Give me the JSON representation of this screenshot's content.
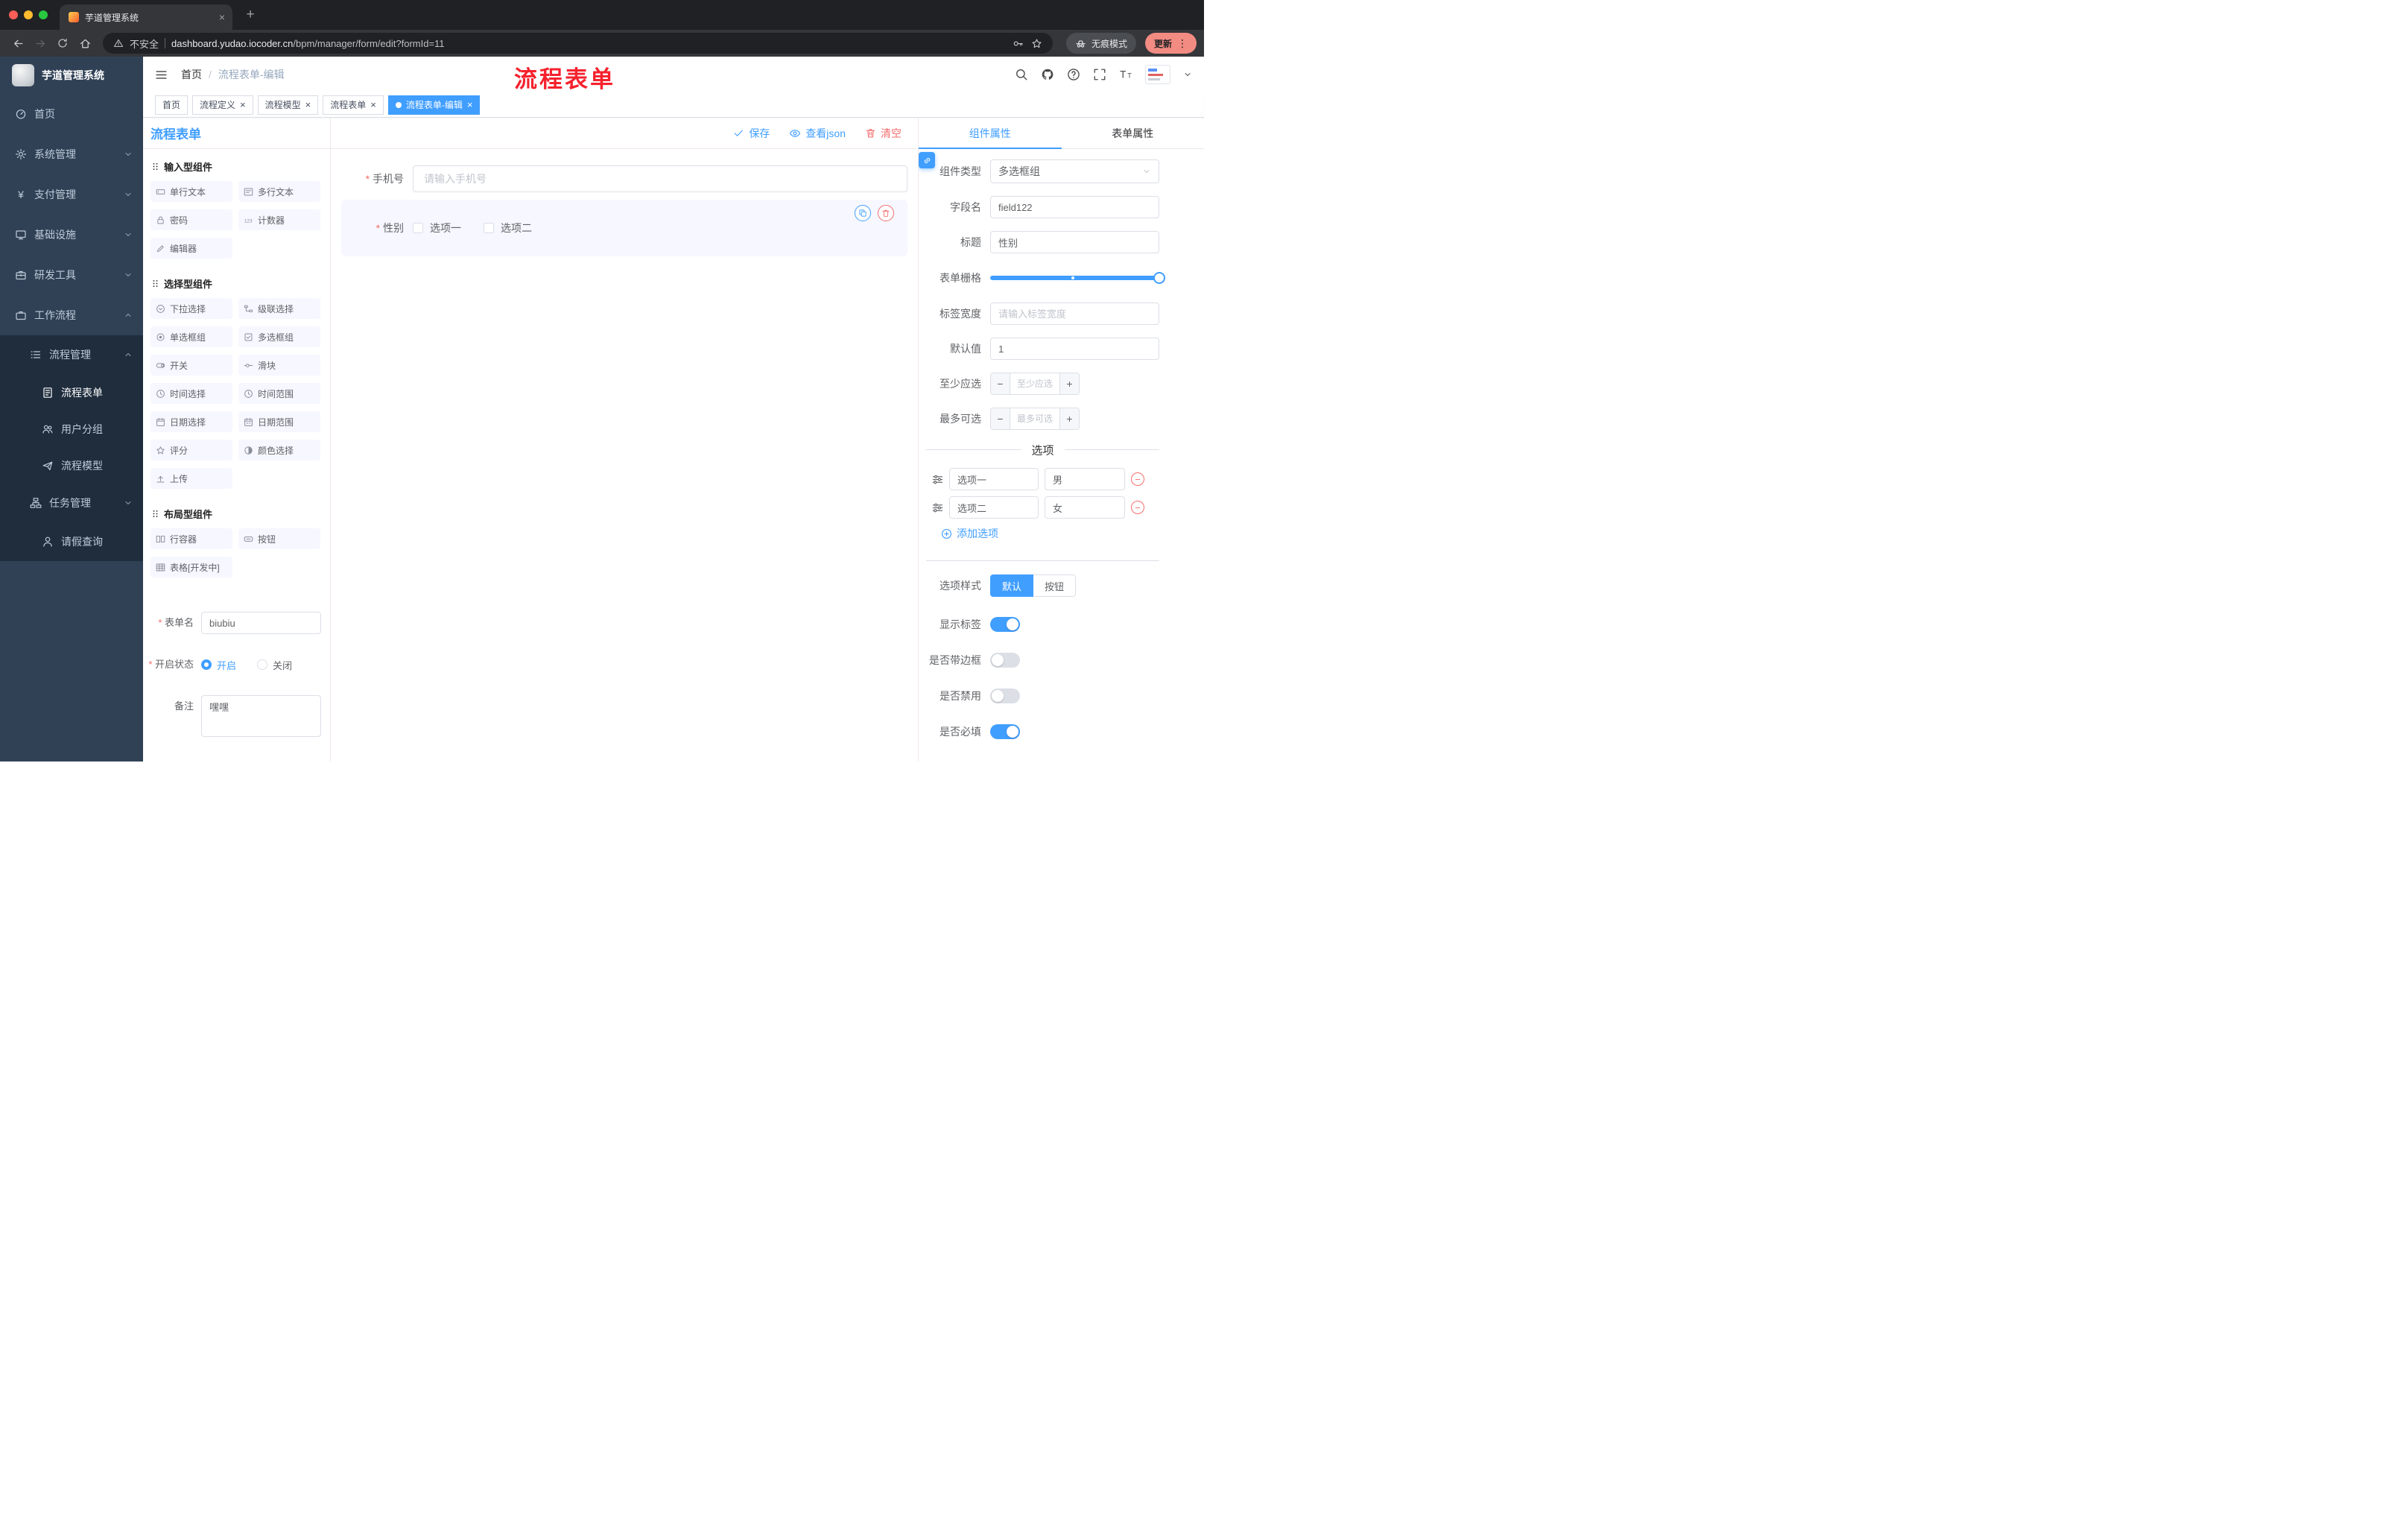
{
  "browser": {
    "tab_title": "芋道管理系统",
    "security_label": "不安全",
    "url_domain": "dashboard.yudao.iocoder.cn",
    "url_path": "/bpm/manager/form/edit?formId=11",
    "incognito_label": "无痕模式",
    "update_label": "更新"
  },
  "sidebar": {
    "logo_title": "芋道管理系统",
    "menu": [
      {
        "label": "首页"
      },
      {
        "label": "系统管理"
      },
      {
        "label": "支付管理"
      },
      {
        "label": "基础设施"
      },
      {
        "label": "研发工具"
      },
      {
        "label": "工作流程"
      },
      {
        "label": "流程管理"
      },
      {
        "label": "流程表单"
      },
      {
        "label": "用户分组"
      },
      {
        "label": "流程模型"
      },
      {
        "label": "任务管理"
      },
      {
        "label": "请假查询"
      }
    ]
  },
  "header": {
    "breadcrumb_home": "首页",
    "breadcrumb_separator": "/",
    "breadcrumb_current": "流程表单-编辑",
    "annotation": "流程表单"
  },
  "tabbar": {
    "tabs": [
      {
        "label": "首页",
        "closable": false,
        "active": false
      },
      {
        "label": "流程定义",
        "closable": true,
        "active": false
      },
      {
        "label": "流程模型",
        "closable": true,
        "active": false
      },
      {
        "label": "流程表单",
        "closable": true,
        "active": false
      },
      {
        "label": "流程表单-编辑",
        "closable": true,
        "active": true
      }
    ]
  },
  "designer": {
    "panel_title": "流程表单",
    "toolbar": {
      "save_label": "保存",
      "view_json_label": "查看json",
      "clear_label": "清空"
    },
    "palette": {
      "groups": [
        {
          "title": "输入型组件",
          "items": [
            "单行文本",
            "多行文本",
            "密码",
            "计数器",
            "编辑器"
          ]
        },
        {
          "title": "选择型组件",
          "items": [
            "下拉选择",
            "级联选择",
            "单选框组",
            "多选框组",
            "开关",
            "滑块",
            "时间选择",
            "时间范围",
            "日期选择",
            "日期范围",
            "评分",
            "颜色选择",
            "上传"
          ]
        },
        {
          "title": "布局型组件",
          "items": [
            "行容器",
            "按钮",
            "表格[开发中]"
          ]
        }
      ]
    },
    "meta": {
      "name_label": "表单名",
      "name_value": "biubiu",
      "status_label": "开启状态",
      "status_on": "开启",
      "status_off": "关闭",
      "status_selected": "开启",
      "remark_label": "备注",
      "remark_value": "嘿嘿"
    },
    "canvas": {
      "phone_field": {
        "label": "手机号",
        "required": true,
        "placeholder": "请输入手机号"
      },
      "gender_field": {
        "label": "性别",
        "required": true,
        "options": [
          "选项一",
          "选项二"
        ],
        "selected": true
      }
    },
    "props": {
      "tab_component": "组件属性",
      "tab_form": "表单属性",
      "active_tab": "组件属性",
      "component_type": {
        "label": "组件类型",
        "value": "多选框组"
      },
      "field_name": {
        "label": "字段名",
        "value": "field122"
      },
      "title": {
        "label": "标题",
        "value": "性别"
      },
      "grid": {
        "label": "表单栅格",
        "value_percent": 100
      },
      "label_width": {
        "label": "标签宽度",
        "placeholder": "请输入标签宽度"
      },
      "default_value": {
        "label": "默认值",
        "value": "1"
      },
      "min_select": {
        "label": "至少应选",
        "placeholder": "至少应选"
      },
      "max_select": {
        "label": "最多可选",
        "placeholder": "最多可选"
      },
      "options_title": "选项",
      "options": [
        {
          "label": "选项一",
          "value": "男"
        },
        {
          "label": "选项二",
          "value": "女"
        }
      ],
      "add_option": "添加选项",
      "option_style": {
        "label": "选项样式",
        "choices": [
          "默认",
          "按钮"
        ],
        "selected": "默认"
      },
      "switches": [
        {
          "label": "显示标签",
          "on": true
        },
        {
          "label": "是否带边框",
          "on": false
        },
        {
          "label": "是否禁用",
          "on": false
        },
        {
          "label": "是否必填",
          "on": true
        }
      ]
    }
  },
  "colors": {
    "accent": "#409eff",
    "danger": "#f56c6c",
    "annotation_red": "#f5222d",
    "sidebar_bg": "#304156",
    "sidebar_submenu_bg": "#1f2d3d",
    "selected_item_bg": "#f6f7ff"
  }
}
